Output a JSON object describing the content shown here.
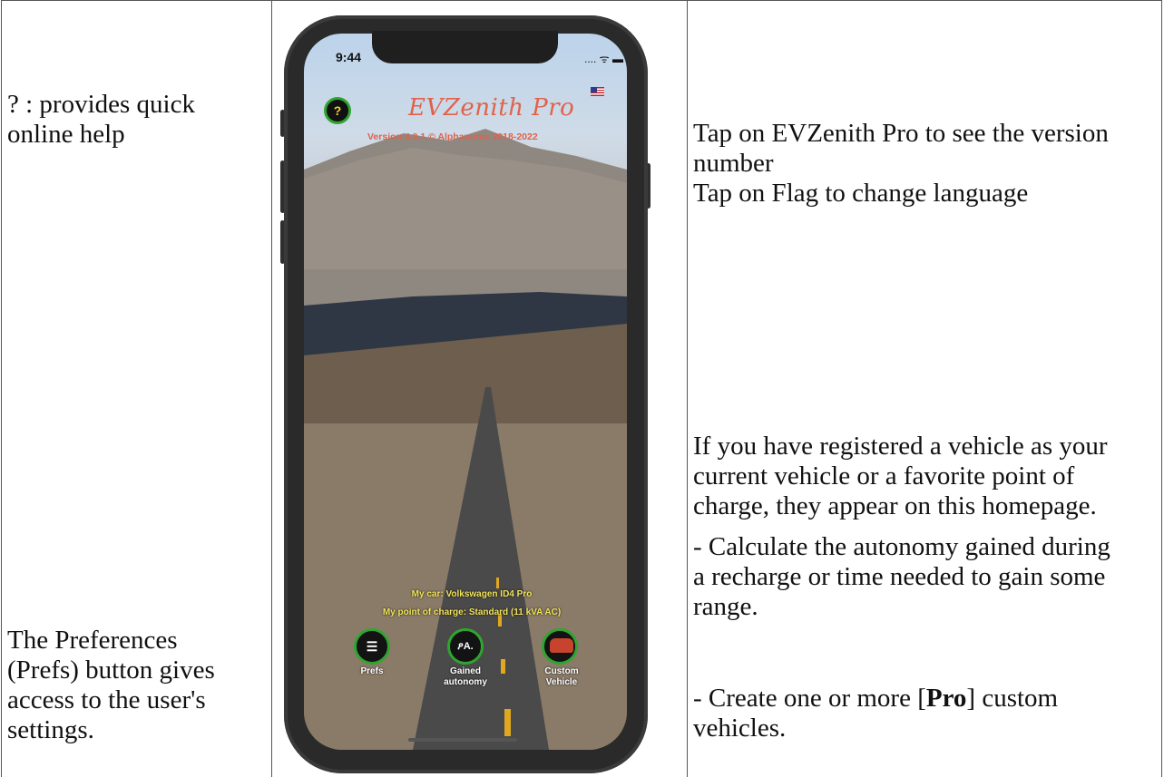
{
  "left_column": {
    "help_note": "? : provides quick\nonline help",
    "prefs_note": "The Preferences\n(Prefs) button gives\naccess to the user's\nsettings."
  },
  "right_column": {
    "title_note": "Tap on EVZenith Pro to see the version\nnumber\nTap on Flag to change language",
    "homepage_note": "If you have registered a vehicle as your\ncurrent vehicle or a favorite point of\ncharge, they appear on this homepage.",
    "autonomy_note": "- Calculate the autonomy gained during\na recharge or time needed to gain some\nrange.",
    "custom_note_prefix": "- Create one or more [",
    "custom_note_bold": "Pro",
    "custom_note_suffix": "] custom\nvehicles."
  },
  "phone": {
    "status_time": "9:44",
    "status_icons": ".... ᯤ ▬",
    "help_label": "?",
    "app_title": "EVZenith Pro",
    "version": "Version 4.0.1 © Alphanums 2018-2022",
    "my_car": "My car: Volkswagen ID4 Pro",
    "my_charge_point": "My point of charge: Standard (11 kVA AC)",
    "buttons": [
      {
        "label": "Prefs",
        "icon": "list-icon",
        "glyph": "☰"
      },
      {
        "label": "Gained\nautonomy",
        "icon": "location-pin-icon",
        "glyph": "ዖA."
      },
      {
        "label": "Custom\nVehicle",
        "icon": "car-icon",
        "glyph": ""
      }
    ],
    "accent_green": "#2fa52f",
    "title_color": "#e0624a",
    "info_color": "#f3e55a"
  }
}
